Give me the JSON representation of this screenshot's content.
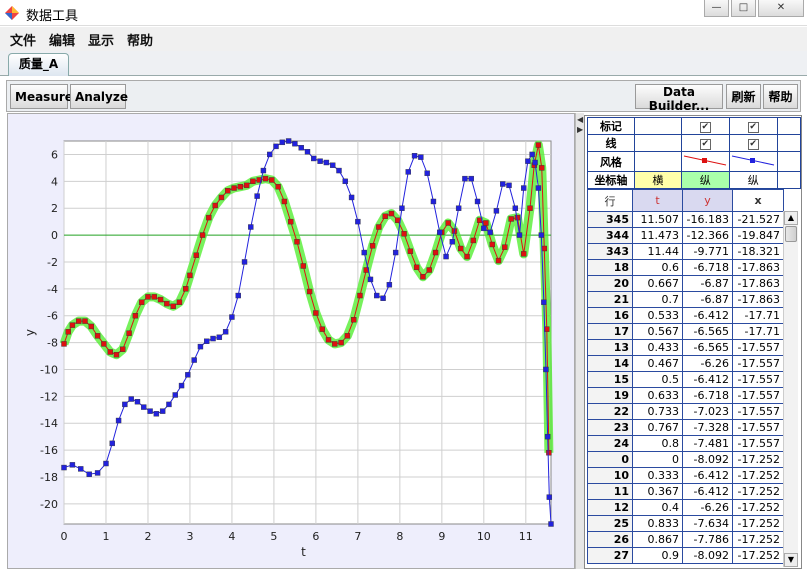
{
  "window": {
    "title": "数据工具",
    "controls": [
      "—",
      "□",
      "✕"
    ]
  },
  "menu": [
    "文件",
    "编辑",
    "显示",
    "帮助"
  ],
  "tabs": [
    {
      "label": "质量_A"
    }
  ],
  "toolbar": {
    "measure": "Measure",
    "analyze": "Analyze",
    "data_builder": "Data Builder...",
    "refresh": "刷新",
    "help": "帮助"
  },
  "controls_table": {
    "rows": [
      {
        "label": "标记",
        "col1": true,
        "col2": true
      },
      {
        "label": "线",
        "col1": true,
        "col2": true
      },
      {
        "label": "风格",
        "col1": "style-red",
        "col2": "style-blue"
      },
      {
        "label": "坐标轴",
        "col1": "横",
        "col2": "纵",
        "col3": "纵"
      }
    ]
  },
  "table": {
    "headers": [
      "行",
      "t",
      "y",
      "x"
    ],
    "rows": [
      [
        "345",
        "11.507",
        "-16.183",
        "-21.527"
      ],
      [
        "344",
        "11.473",
        "-12.366",
        "-19.847"
      ],
      [
        "343",
        "11.44",
        "-9.771",
        "-18.321"
      ],
      [
        "18",
        "0.6",
        "-6.718",
        "-17.863"
      ],
      [
        "20",
        "0.667",
        "-6.87",
        "-17.863"
      ],
      [
        "21",
        "0.7",
        "-6.87",
        "-17.863"
      ],
      [
        "16",
        "0.533",
        "-6.412",
        "-17.71"
      ],
      [
        "17",
        "0.567",
        "-6.565",
        "-17.71"
      ],
      [
        "13",
        "0.433",
        "-6.565",
        "-17.557"
      ],
      [
        "14",
        "0.467",
        "-6.26",
        "-17.557"
      ],
      [
        "15",
        "0.5",
        "-6.412",
        "-17.557"
      ],
      [
        "19",
        "0.633",
        "-6.718",
        "-17.557"
      ],
      [
        "22",
        "0.733",
        "-7.023",
        "-17.557"
      ],
      [
        "23",
        "0.767",
        "-7.328",
        "-17.557"
      ],
      [
        "24",
        "0.8",
        "-7.481",
        "-17.557"
      ],
      [
        "0",
        "0",
        "-8.092",
        "-17.252"
      ],
      [
        "10",
        "0.333",
        "-6.412",
        "-17.252"
      ],
      [
        "11",
        "0.367",
        "-6.412",
        "-17.252"
      ],
      [
        "12",
        "0.4",
        "-6.26",
        "-17.252"
      ],
      [
        "25",
        "0.833",
        "-7.634",
        "-17.252"
      ],
      [
        "26",
        "0.867",
        "-7.786",
        "-17.252"
      ],
      [
        "27",
        "0.9",
        "-8.092",
        "-17.252"
      ]
    ]
  },
  "chart_data": {
    "type": "scatter",
    "xlabel": "t",
    "ylabel": "y",
    "xlim": [
      0,
      11.6
    ],
    "ylim": [
      -21.5,
      7
    ],
    "xticks": [
      "0",
      "1",
      "2",
      "3",
      "4",
      "5",
      "6",
      "7",
      "8",
      "9",
      "10",
      "11"
    ],
    "yticks": [
      "6",
      "4",
      "2",
      "0",
      "-2",
      "-4",
      "-6",
      "-8",
      "-10",
      "-12",
      "-14",
      "-16",
      "-18",
      "-20"
    ],
    "grid": true,
    "series": [
      {
        "color": "#dd1111",
        "highlight": "#55ee33",
        "points": [
          [
            0,
            -8.1
          ],
          [
            0.1,
            -7.2
          ],
          [
            0.2,
            -6.7
          ],
          [
            0.35,
            -6.4
          ],
          [
            0.5,
            -6.4
          ],
          [
            0.65,
            -6.8
          ],
          [
            0.8,
            -7.5
          ],
          [
            0.95,
            -8.1
          ],
          [
            1.1,
            -8.7
          ],
          [
            1.25,
            -8.9
          ],
          [
            1.4,
            -8.5
          ],
          [
            1.55,
            -7.3
          ],
          [
            1.7,
            -6.0
          ],
          [
            1.85,
            -5.0
          ],
          [
            2.0,
            -4.6
          ],
          [
            2.15,
            -4.6
          ],
          [
            2.3,
            -4.8
          ],
          [
            2.45,
            -5.1
          ],
          [
            2.6,
            -5.3
          ],
          [
            2.75,
            -5.0
          ],
          [
            2.9,
            -4.0
          ],
          [
            3.0,
            -3.0
          ],
          [
            3.15,
            -1.5
          ],
          [
            3.3,
            0.0
          ],
          [
            3.45,
            1.3
          ],
          [
            3.6,
            2.2
          ],
          [
            3.75,
            2.8
          ],
          [
            3.9,
            3.3
          ],
          [
            4.05,
            3.5
          ],
          [
            4.2,
            3.6
          ],
          [
            4.35,
            3.7
          ],
          [
            4.5,
            4.0
          ],
          [
            4.65,
            4.1
          ],
          [
            4.8,
            4.2
          ],
          [
            4.95,
            4.1
          ],
          [
            5.1,
            3.6
          ],
          [
            5.25,
            2.5
          ],
          [
            5.4,
            1.0
          ],
          [
            5.55,
            -0.5
          ],
          [
            5.7,
            -2.3
          ],
          [
            5.85,
            -4.2
          ],
          [
            6.0,
            -5.8
          ],
          [
            6.15,
            -7.0
          ],
          [
            6.3,
            -7.8
          ],
          [
            6.45,
            -8.1
          ],
          [
            6.6,
            -8.0
          ],
          [
            6.75,
            -7.5
          ],
          [
            6.9,
            -6.3
          ],
          [
            7.05,
            -4.5
          ],
          [
            7.2,
            -2.6
          ],
          [
            7.35,
            -0.8
          ],
          [
            7.5,
            0.6
          ],
          [
            7.65,
            1.4
          ],
          [
            7.8,
            1.6
          ],
          [
            7.95,
            1.1
          ],
          [
            8.1,
            0.1
          ],
          [
            8.25,
            -1.2
          ],
          [
            8.4,
            -2.4
          ],
          [
            8.55,
            -3.1
          ],
          [
            8.7,
            -2.6
          ],
          [
            8.85,
            -1.3
          ],
          [
            9.0,
            0.2
          ],
          [
            9.15,
            0.9
          ],
          [
            9.3,
            0.3
          ],
          [
            9.45,
            -1.0
          ],
          [
            9.6,
            -1.6
          ],
          [
            9.75,
            -0.4
          ],
          [
            9.9,
            1.1
          ],
          [
            10.05,
            0.9
          ],
          [
            10.2,
            -0.7
          ],
          [
            10.35,
            -1.9
          ],
          [
            10.5,
            -0.9
          ],
          [
            10.65,
            1.2
          ],
          [
            10.8,
            1.3
          ],
          [
            10.95,
            -1.4
          ],
          [
            11.1,
            2.0
          ],
          [
            11.2,
            5.2
          ],
          [
            11.3,
            6.7
          ],
          [
            11.38,
            5.0
          ],
          [
            11.44,
            -1.0
          ],
          [
            11.5,
            -7.0
          ],
          [
            11.55,
            -16.2
          ]
        ]
      },
      {
        "color": "#2222dd",
        "points": [
          [
            0,
            -17.3
          ],
          [
            0.2,
            -17.1
          ],
          [
            0.4,
            -17.4
          ],
          [
            0.6,
            -17.8
          ],
          [
            0.8,
            -17.7
          ],
          [
            1.0,
            -17.0
          ],
          [
            1.15,
            -15.5
          ],
          [
            1.3,
            -13.8
          ],
          [
            1.45,
            -12.6
          ],
          [
            1.6,
            -12.2
          ],
          [
            1.75,
            -12.4
          ],
          [
            1.9,
            -12.8
          ],
          [
            2.05,
            -13.1
          ],
          [
            2.2,
            -13.3
          ],
          [
            2.35,
            -13.1
          ],
          [
            2.5,
            -12.6
          ],
          [
            2.65,
            -11.9
          ],
          [
            2.8,
            -11.2
          ],
          [
            2.95,
            -10.4
          ],
          [
            3.1,
            -9.3
          ],
          [
            3.25,
            -8.3
          ],
          [
            3.4,
            -7.9
          ],
          [
            3.55,
            -7.7
          ],
          [
            3.7,
            -7.6
          ],
          [
            3.85,
            -7.2
          ],
          [
            4.0,
            -6.1
          ],
          [
            4.15,
            -4.5
          ],
          [
            4.3,
            -2.0
          ],
          [
            4.45,
            0.6
          ],
          [
            4.6,
            2.9
          ],
          [
            4.75,
            4.8
          ],
          [
            4.9,
            6.0
          ],
          [
            5.05,
            6.6
          ],
          [
            5.2,
            6.9
          ],
          [
            5.35,
            7.0
          ],
          [
            5.5,
            6.8
          ],
          [
            5.65,
            6.5
          ],
          [
            5.8,
            6.2
          ],
          [
            5.95,
            5.7
          ],
          [
            6.1,
            5.5
          ],
          [
            6.25,
            5.4
          ],
          [
            6.4,
            5.2
          ],
          [
            6.55,
            4.8
          ],
          [
            6.7,
            4.0
          ],
          [
            6.85,
            2.8
          ],
          [
            7.0,
            1.0
          ],
          [
            7.15,
            -1.3
          ],
          [
            7.3,
            -3.3
          ],
          [
            7.45,
            -4.5
          ],
          [
            7.6,
            -4.7
          ],
          [
            7.75,
            -3.7
          ],
          [
            7.9,
            -1.3
          ],
          [
            8.05,
            2.0
          ],
          [
            8.2,
            4.7
          ],
          [
            8.35,
            5.9
          ],
          [
            8.5,
            5.8
          ],
          [
            8.65,
            4.6
          ],
          [
            8.8,
            2.5
          ],
          [
            8.95,
            0.2
          ],
          [
            9.1,
            -1.6
          ],
          [
            9.25,
            -0.5
          ],
          [
            9.4,
            2.0
          ],
          [
            9.55,
            4.2
          ],
          [
            9.7,
            4.2
          ],
          [
            9.85,
            2.5
          ],
          [
            10.0,
            0.5
          ],
          [
            10.15,
            0.2
          ],
          [
            10.3,
            1.8
          ],
          [
            10.45,
            3.8
          ],
          [
            10.6,
            3.7
          ],
          [
            10.75,
            2.0
          ],
          [
            10.85,
            0.0
          ],
          [
            10.95,
            3.5
          ],
          [
            11.05,
            5.5
          ],
          [
            11.15,
            6.0
          ],
          [
            11.22,
            5.4
          ],
          [
            11.3,
            3.5
          ],
          [
            11.37,
            0.0
          ],
          [
            11.43,
            -5.0
          ],
          [
            11.48,
            -10.0
          ],
          [
            11.52,
            -15.0
          ],
          [
            11.56,
            -19.5
          ],
          [
            11.6,
            -21.5
          ]
        ]
      }
    ]
  }
}
